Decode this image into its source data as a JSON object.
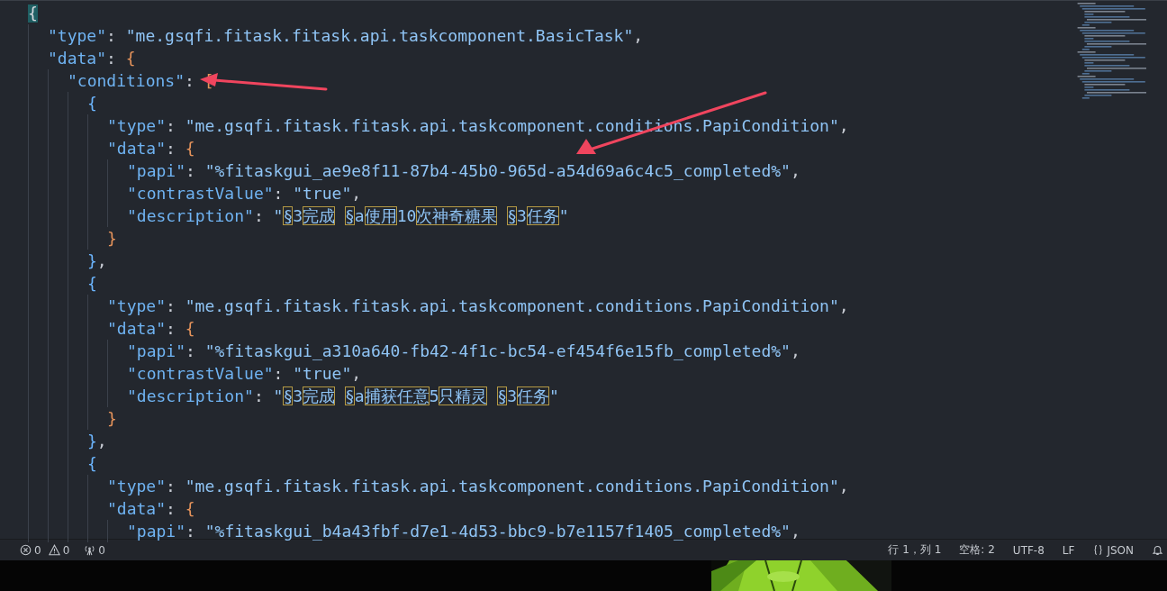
{
  "editor": {
    "lines": [
      {
        "tokens": [
          {
            "kind": "open",
            "text": "{",
            "matched": true
          }
        ]
      },
      {
        "tokens": [
          {
            "kind": "key",
            "text": "\"type\""
          },
          {
            "kind": "punct",
            "text": ": "
          },
          {
            "kind": "string",
            "text": "\"me.gsqfi.fitask.fitask.api.taskcomponent.BasicTask\""
          },
          {
            "kind": "punct",
            "text": ","
          }
        ]
      },
      {
        "tokens": [
          {
            "kind": "key",
            "text": "\"data\""
          },
          {
            "kind": "punct",
            "text": ": "
          },
          {
            "kind": "open",
            "text": "{",
            "color": "#e5935b",
            "matched": false
          }
        ]
      },
      {
        "tokens": [
          {
            "kind": "key",
            "text": "\"conditions\""
          },
          {
            "kind": "punct",
            "text": ": "
          },
          {
            "kind": "open",
            "text": "[",
            "color": "#e5935b",
            "matched": false
          }
        ]
      },
      {
        "tokens": [
          {
            "kind": "open",
            "text": "{",
            "color": "#6cb6ff",
            "matched": false
          }
        ]
      },
      {
        "tokens": [
          {
            "kind": "key",
            "text": "\"type\""
          },
          {
            "kind": "punct",
            "text": ": "
          },
          {
            "kind": "string",
            "text": "\"me.gsqfi.fitask.fitask.api.taskcomponent.conditions.PapiCondition\""
          },
          {
            "kind": "punct",
            "text": ","
          }
        ]
      },
      {
        "tokens": [
          {
            "kind": "key",
            "text": "\"data\""
          },
          {
            "kind": "punct",
            "text": ": "
          },
          {
            "kind": "open",
            "text": "{",
            "color": "#e5935b",
            "matched": false
          }
        ]
      },
      {
        "tokens": [
          {
            "kind": "key",
            "text": "\"papi\""
          },
          {
            "kind": "punct",
            "text": ": "
          },
          {
            "kind": "string",
            "text": "\"%fitaskgui_ae9e8f11-87b4-45b0-965d-a54d69a6c4c5_completed%\""
          },
          {
            "kind": "punct",
            "text": ","
          }
        ]
      },
      {
        "tokens": [
          {
            "kind": "key",
            "text": "\"contrastValue\""
          },
          {
            "kind": "punct",
            "text": ": "
          },
          {
            "kind": "string",
            "text": "\"true\""
          },
          {
            "kind": "punct",
            "text": ","
          }
        ]
      },
      {
        "tokens": [
          {
            "kind": "key",
            "text": "\"description\""
          },
          {
            "kind": "punct",
            "text": ": "
          },
          {
            "kind": "string",
            "text": "\""
          },
          {
            "kind": "boxed",
            "text": "§"
          },
          {
            "kind": "string",
            "text": "3"
          },
          {
            "kind": "boxed",
            "text": "完成 "
          },
          {
            "kind": "boxed",
            "text": "§"
          },
          {
            "kind": "string",
            "text": "a"
          },
          {
            "kind": "boxed",
            "text": "使用"
          },
          {
            "kind": "string",
            "text": "10"
          },
          {
            "kind": "boxed",
            "text": "次神奇糖果 "
          },
          {
            "kind": "boxed",
            "text": "§"
          },
          {
            "kind": "string",
            "text": "3"
          },
          {
            "kind": "boxed",
            "text": "任务"
          },
          {
            "kind": "string",
            "text": "\""
          }
        ]
      },
      {
        "tokens": [
          {
            "kind": "close",
            "text": "}",
            "color": "#e5935b",
            "matched": false
          }
        ]
      },
      {
        "tokens": [
          {
            "kind": "close",
            "text": "}",
            "color": "#6cb6ff",
            "matched": false
          },
          {
            "kind": "punct",
            "text": ","
          }
        ]
      },
      {
        "tokens": [
          {
            "kind": "open",
            "text": "{",
            "color": "#6cb6ff",
            "matched": false
          }
        ]
      },
      {
        "tokens": [
          {
            "kind": "key",
            "text": "\"type\""
          },
          {
            "kind": "punct",
            "text": ": "
          },
          {
            "kind": "string",
            "text": "\"me.gsqfi.fitask.fitask.api.taskcomponent.conditions.PapiCondition\""
          },
          {
            "kind": "punct",
            "text": ","
          }
        ]
      },
      {
        "tokens": [
          {
            "kind": "key",
            "text": "\"data\""
          },
          {
            "kind": "punct",
            "text": ": "
          },
          {
            "kind": "open",
            "text": "{",
            "color": "#e5935b",
            "matched": false
          }
        ]
      },
      {
        "tokens": [
          {
            "kind": "key",
            "text": "\"papi\""
          },
          {
            "kind": "punct",
            "text": ": "
          },
          {
            "kind": "string",
            "text": "\"%fitaskgui_a310a640-fb42-4f1c-bc54-ef454f6e15fb_completed%\""
          },
          {
            "kind": "punct",
            "text": ","
          }
        ]
      },
      {
        "tokens": [
          {
            "kind": "key",
            "text": "\"contrastValue\""
          },
          {
            "kind": "punct",
            "text": ": "
          },
          {
            "kind": "string",
            "text": "\"true\""
          },
          {
            "kind": "punct",
            "text": ","
          }
        ]
      },
      {
        "tokens": [
          {
            "kind": "key",
            "text": "\"description\""
          },
          {
            "kind": "punct",
            "text": ": "
          },
          {
            "kind": "string",
            "text": "\""
          },
          {
            "kind": "boxed",
            "text": "§"
          },
          {
            "kind": "string",
            "text": "3"
          },
          {
            "kind": "boxed",
            "text": "完成 "
          },
          {
            "kind": "boxed",
            "text": "§"
          },
          {
            "kind": "string",
            "text": "a"
          },
          {
            "kind": "boxed",
            "text": "捕获任意"
          },
          {
            "kind": "string",
            "text": "5"
          },
          {
            "kind": "boxed",
            "text": "只精灵 "
          },
          {
            "kind": "boxed",
            "text": "§"
          },
          {
            "kind": "string",
            "text": "3"
          },
          {
            "kind": "boxed",
            "text": "任务"
          },
          {
            "kind": "string",
            "text": "\""
          }
        ]
      },
      {
        "tokens": [
          {
            "kind": "close",
            "text": "}",
            "color": "#e5935b",
            "matched": false
          }
        ]
      },
      {
        "tokens": [
          {
            "kind": "close",
            "text": "}",
            "color": "#6cb6ff",
            "matched": false
          },
          {
            "kind": "punct",
            "text": ","
          }
        ]
      },
      {
        "tokens": [
          {
            "kind": "open",
            "text": "{",
            "color": "#6cb6ff",
            "matched": false
          }
        ]
      },
      {
        "tokens": [
          {
            "kind": "key",
            "text": "\"type\""
          },
          {
            "kind": "punct",
            "text": ": "
          },
          {
            "kind": "string",
            "text": "\"me.gsqfi.fitask.fitask.api.taskcomponent.conditions.PapiCondition\""
          },
          {
            "kind": "punct",
            "text": ","
          }
        ]
      },
      {
        "tokens": [
          {
            "kind": "key",
            "text": "\"data\""
          },
          {
            "kind": "punct",
            "text": ": "
          },
          {
            "kind": "open",
            "text": "{",
            "color": "#e5935b",
            "matched": false
          }
        ]
      },
      {
        "tokens": [
          {
            "kind": "key",
            "text": "\"papi\""
          },
          {
            "kind": "punct",
            "text": ": "
          },
          {
            "kind": "string",
            "text": "\"%fitaskgui_b4a43fbf-d7e1-4d53-bbc9-b7e1157f1405_completed%\""
          },
          {
            "kind": "punct",
            "text": ","
          }
        ]
      }
    ]
  },
  "annotations": [
    {
      "kind": "arrow"
    },
    {
      "kind": "arrow"
    }
  ],
  "status_bar": {
    "left": [
      {
        "kind": "errors",
        "text": "0"
      },
      {
        "kind": "warnings",
        "text": "0"
      },
      {
        "kind": "ports",
        "text": "0"
      }
    ],
    "right": [
      {
        "kind": "text",
        "text": "行 1，列 1"
      },
      {
        "kind": "text",
        "text": "空格: 2"
      },
      {
        "kind": "text",
        "text": "UTF-8"
      },
      {
        "kind": "text",
        "text": "LF"
      },
      {
        "kind": "language",
        "text": "JSON"
      },
      {
        "kind": "bell"
      }
    ]
  }
}
